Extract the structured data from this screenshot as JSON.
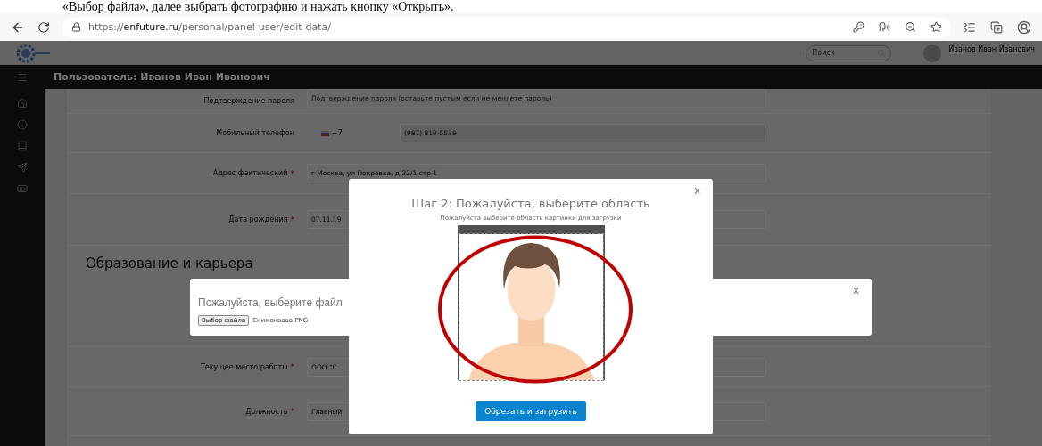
{
  "instruction_text": "«Выбор файла», далее выбрать фотографию и нажать кнопку «Открыть».",
  "browser": {
    "url": "https://**enfuture.ru**/personal/panel-user/edit-data/"
  },
  "header": {
    "search_placeholder": "Поиск",
    "user_name": "Иванов Иван Иванович"
  },
  "page_title": "Пользователь: Иванов Иван Иванович",
  "form_rows": [
    {
      "kind": "text",
      "label": "Подтверждение пароля",
      "placeholder": "Подтверждение пароля (оставьте пустым если не меняете пароль)"
    },
    {
      "kind": "phone",
      "label": "Мобильный телефон",
      "code": "+7",
      "value": "(987) 819-5539"
    },
    {
      "kind": "text",
      "label": "Адрес фактический",
      "required_mark": "*",
      "value": "г Москва, ул Покровка, д 22/1 стр 1"
    },
    {
      "kind": "text",
      "label": "Дата рождения",
      "required_mark": "*",
      "value": "07.11.19"
    },
    {
      "kind": "heading",
      "label": "Образование и карьера"
    },
    {
      "kind": "spacer"
    },
    {
      "kind": "text",
      "label": "Текущее место работы",
      "required_mark": "*",
      "value": "ООО \"С"
    },
    {
      "kind": "text",
      "label": "Должность",
      "required_mark": "*",
      "value": "Главный"
    }
  ],
  "file_dialog": {
    "title": "Пожалуйста, выберите файл",
    "button": "Выбор файла",
    "file_name": "Снимокаааа.PNG",
    "close": "x"
  },
  "crop_dialog": {
    "title": "Шаг 2: Пожалуйста, выберите область",
    "subtitle": "Пожалуйста выберите область картинки для загрузки",
    "button": "Обрезать и загрузить",
    "close": "x"
  }
}
